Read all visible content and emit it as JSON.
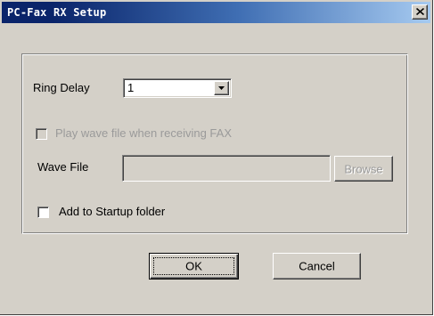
{
  "window": {
    "title": "PC-Fax RX Setup",
    "close_icon": "close-icon"
  },
  "ring_delay": {
    "label": "Ring Delay",
    "value": "1",
    "dropdown_icon": "chevron-down-icon"
  },
  "play_wave": {
    "label": "Play wave file when receiving FAX",
    "checked": false,
    "enabled": false
  },
  "wave_file": {
    "label": "Wave File",
    "value": "",
    "browse_label": "Browse"
  },
  "startup": {
    "label": "Add to Startup folder",
    "checked": false
  },
  "buttons": {
    "ok_label": "OK",
    "cancel_label": "Cancel"
  },
  "colors": {
    "title_bar_start": "#0a246a",
    "title_bar_end": "#a6caf0",
    "dialog_face": "#d4d0c8",
    "disabled_text": "#9a9a9a"
  }
}
